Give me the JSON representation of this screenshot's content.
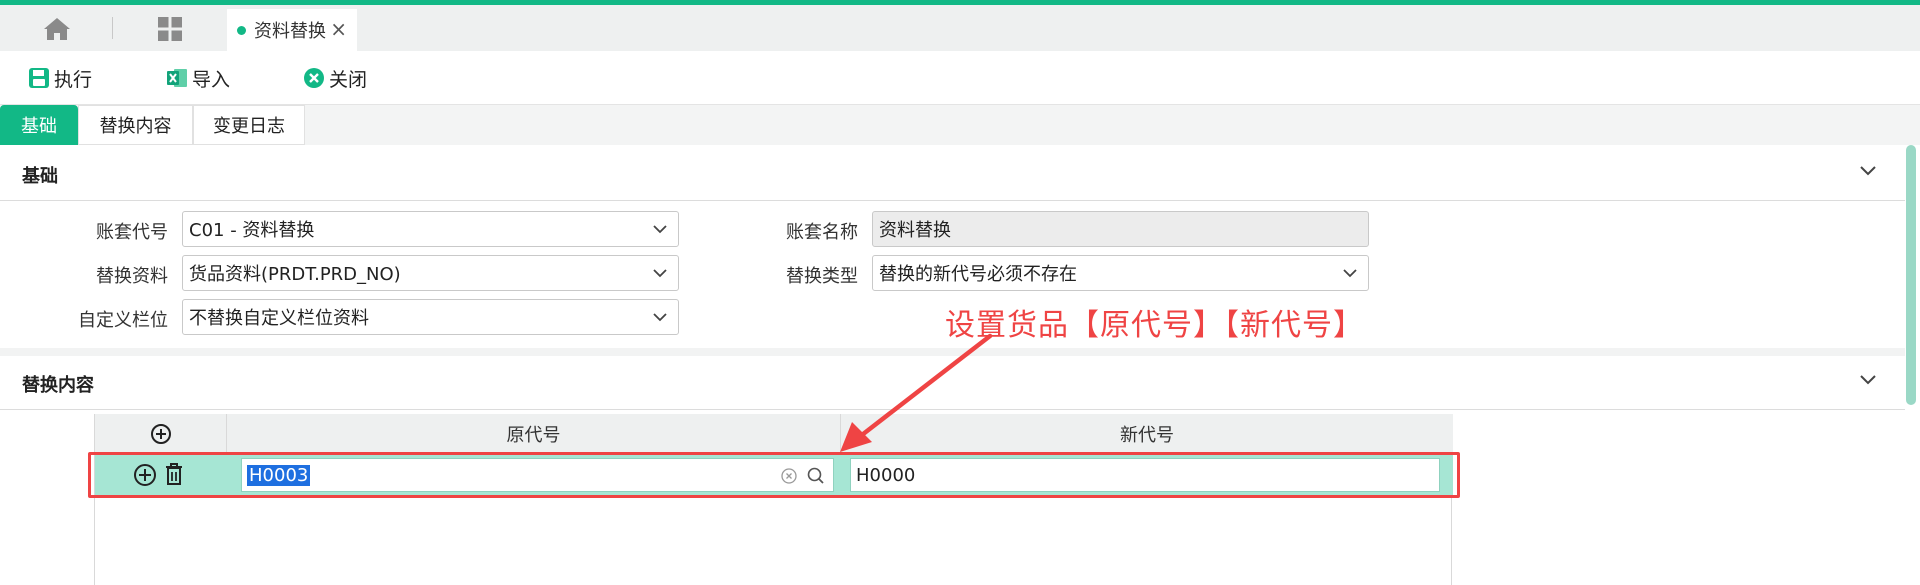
{
  "tabbar": {
    "home_icon": "home-icon",
    "apps_icon": "grid-icon",
    "active_tab": "资料替换",
    "close_glyph": "×"
  },
  "toolbar": {
    "execute_label": "执行",
    "import_label": "导入",
    "close_label": "关闭"
  },
  "subtabs": [
    "基础",
    "替换内容",
    "变更日志"
  ],
  "basic": {
    "title": "基础",
    "fields": {
      "account_code_label": "账套代号",
      "account_code_value": "C01 - 资料替换",
      "account_name_label": "账套名称",
      "account_name_value": "资料替换",
      "replace_data_label": "替换资料",
      "replace_data_value": "货品资料(PRDT.PRD_NO)",
      "replace_type_label": "替换类型",
      "replace_type_value": "替换的新代号必须不存在",
      "custom_field_label": "自定义栏位",
      "custom_field_value": "不替换自定义栏位资料"
    }
  },
  "content": {
    "title": "替换内容",
    "columns": [
      "原代号",
      "新代号"
    ],
    "rows": [
      {
        "old_code": "H0003",
        "new_code": "H0000"
      }
    ]
  },
  "annotation": "设置货品【原代号】【新代号】",
  "colors": {
    "accent": "#12b886",
    "annotation": "#ef4444",
    "selection": "#1e6fe0"
  }
}
